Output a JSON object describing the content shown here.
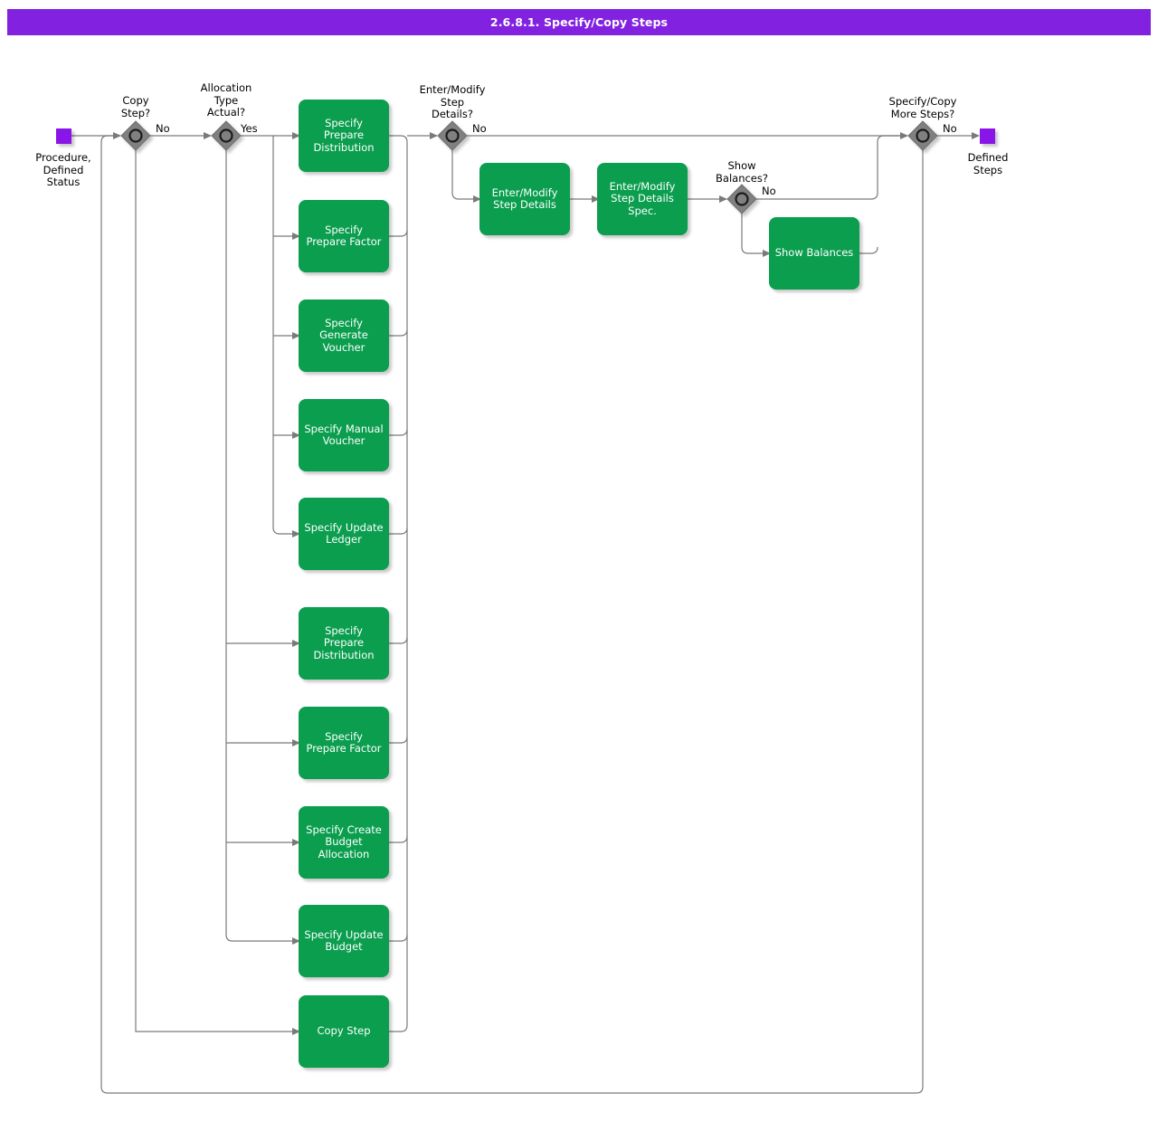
{
  "header": {
    "title": "2.6.8.1. Specify/Copy Steps",
    "bar_color": "#8222E0",
    "text_color": "#ffffff"
  },
  "theme": {
    "process_fill": "#0A9E4E",
    "process_text": "#ffffff",
    "terminator_fill": "#8A15E8",
    "decision_fill": "#808080",
    "wire_color": "#777777"
  },
  "terminators": [
    {
      "id": "start",
      "label": "Procedure,\nDefined\nStatus"
    },
    {
      "id": "end",
      "label": "Defined\nSteps"
    }
  ],
  "decisions": [
    {
      "id": "copy-step",
      "label": "Copy\nStep?",
      "branch": "No"
    },
    {
      "id": "allocation-type-actual",
      "label": "Allocation\nType\nActual?",
      "branch": "Yes"
    },
    {
      "id": "enter-modify-step-details",
      "label": "Enter/Modify\nStep\nDetails?",
      "branch": "No"
    },
    {
      "id": "show-balances",
      "label": "Show\nBalances?",
      "branch": "No"
    },
    {
      "id": "specify-copy-more-steps",
      "label": "Specify/Copy\nMore Steps?",
      "branch": "No"
    }
  ],
  "processes": [
    {
      "id": "specify-prepare-distribution-actual",
      "label": "Specify\nPrepare\nDistribution"
    },
    {
      "id": "specify-prepare-factor-actual",
      "label": "Specify\nPrepare\nFactor"
    },
    {
      "id": "specify-generate-voucher",
      "label": "Specify\nGenerate\nVoucher"
    },
    {
      "id": "specify-manual-voucher",
      "label": "Specify Manual\nVoucher"
    },
    {
      "id": "specify-update-ledger",
      "label": "Specify\nUpdate\nLedger"
    },
    {
      "id": "specify-prepare-distribution-budget",
      "label": "Specify Prepare\nDistribution"
    },
    {
      "id": "specify-prepare-factor-budget",
      "label": "Specify Prepare\nFactor"
    },
    {
      "id": "specify-create-budget-allocation",
      "label": "Specify Create\nBudget\nAllocation"
    },
    {
      "id": "specify-update-budget",
      "label": "Specify\nUpdate\nBudget"
    },
    {
      "id": "copy-step",
      "label": "Copy Step"
    },
    {
      "id": "enter-modify-step-details",
      "label": "Enter/Modify\nStep Details"
    },
    {
      "id": "enter-modify-step-details-spec",
      "label": "Enter/Modify\nStep Details\nSpec."
    },
    {
      "id": "show-balances",
      "label": "Show Balances"
    }
  ]
}
